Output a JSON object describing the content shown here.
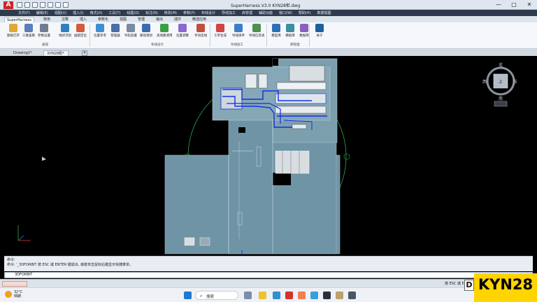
{
  "window": {
    "title": "SuperHarness V3.0    KYN28柜.dwg",
    "minimize": "—",
    "maximize": "□",
    "close": "✕"
  },
  "menus": [
    "文件(F)",
    "编辑(E)",
    "视图(V)",
    "插入(I)",
    "格式(O)",
    "工具(T)",
    "绘图(D)",
    "标注(N)",
    "修改(M)",
    "参数(P)",
    "布线设计",
    "导线加工",
    "库管理",
    "辅助功能",
    "窗口(W)",
    "帮助(H)",
    "数据视图"
  ],
  "ribbon_tabs": [
    "SuperHarness",
    "常用",
    "注释",
    "插入",
    "参数化",
    "视图",
    "管理",
    "输出",
    "插件",
    "精选应用"
  ],
  "ribbon": {
    "buttons": [
      {
        "label": "图纸打开",
        "icon": "folder-open-icon",
        "color": "#e0a838"
      },
      {
        "label": "三维查看",
        "icon": "cube-view-icon",
        "color": "#5b7fb8"
      },
      {
        "label": "参数设置",
        "icon": "gear-icon",
        "color": "#6d7d92"
      },
      {
        "label": "线状识别",
        "icon": "wire-recognize-icon",
        "color": "#2f7fc4"
      },
      {
        "label": "插配定位",
        "icon": "locate-icon",
        "color": "#d45b3b"
      },
      {
        "label": "位置参考",
        "icon": "position-ref-icon",
        "color": "#3c8fd0"
      },
      {
        "label": "管理器",
        "icon": "manager-icon",
        "color": "#4a6fa6"
      },
      {
        "label": "导轨放置",
        "icon": "rail-place-icon",
        "color": "#7a8aa0"
      },
      {
        "label": "路径规划",
        "icon": "route-plan-icon",
        "color": "#3a6bb0"
      },
      {
        "label": "高线路调用",
        "icon": "route-call-icon",
        "color": "#3aa048"
      },
      {
        "label": "位置调整",
        "icon": "adjust-icon",
        "color": "#8a6ad0"
      },
      {
        "label": "手动连线",
        "icon": "manual-wire-icon",
        "color": "#c0503a"
      },
      {
        "label": "工单生成",
        "icon": "work-order-icon",
        "color": "#d04545"
      },
      {
        "label": "导线清单",
        "icon": "wire-list-icon",
        "color": "#3a7fc8"
      },
      {
        "label": "导线信息表",
        "icon": "wire-info-icon",
        "color": "#4f8f4f"
      },
      {
        "label": "模型库",
        "icon": "model-lib-icon",
        "color": "#2f6fb8"
      },
      {
        "label": "模板库",
        "icon": "template-lib-icon",
        "color": "#3c8f9f"
      },
      {
        "label": "数据库",
        "icon": "database-icon",
        "color": "#8a5fc0"
      },
      {
        "label": "关于",
        "icon": "about-icon",
        "color": "#1f5fa0"
      }
    ],
    "groups": [
      "通道",
      "布线设计",
      "导线加工",
      "库管理"
    ]
  },
  "doc_tabs": [
    "Drawing1*",
    "KYN28柜*"
  ],
  "navcube": {
    "north": "北",
    "south": "南",
    "east": "东",
    "west": "西",
    "top": "上"
  },
  "command": {
    "history": [
      "命令:",
      "命令: '_3DFORBIT 按 ESC 或 ENTER 键退出, 或者单击鼠标右键显示快捷菜单。"
    ],
    "input": "3DFORBIT"
  },
  "status": {
    "right": "按 ESC 或 EN..."
  },
  "taskbar": {
    "temperature": "32°C",
    "weather": "晴朗",
    "search": "搜索"
  },
  "watermark": {
    "brand": "KYN28",
    "strip": "D"
  },
  "colors": {
    "accent": "#c9262a",
    "cabinet": "#6f94a6",
    "orbit": "#2ea84a",
    "wire": "#1030e0",
    "badge": "#ffd400"
  }
}
